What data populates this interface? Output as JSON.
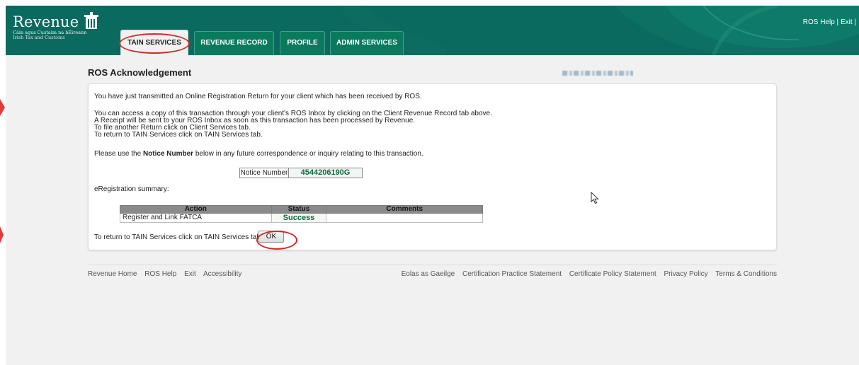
{
  "header": {
    "logo": {
      "wordmark": "Revenue",
      "subtitle_irish": "Cáin agus Custaim na hÉireann",
      "subtitle_english": "Irish Tax and Customs"
    },
    "links": {
      "help": "ROS Help",
      "separator1": " | ",
      "exit": "Exit",
      "separator2": " |"
    },
    "tabs": [
      {
        "label": "TAIN SERVICES",
        "active": true
      },
      {
        "label": "REVENUE RECORD",
        "active": false
      },
      {
        "label": "PROFILE",
        "active": false
      },
      {
        "label": "ADMIN SERVICES",
        "active": false
      }
    ],
    "colors": {
      "header_bg": "#0b6a5f",
      "tab_bg": "#0a7a5e",
      "highlight": "#d22b24"
    }
  },
  "page": {
    "title": "ROS Acknowledgement"
  },
  "panel": {
    "line1": "You have just transmitted an Online Registration Return for your client which has been received by ROS.",
    "line2": "You can access a copy of this transaction through your client's ROS Inbox by clicking on the Client Revenue Record tab above.",
    "line3": "A Receipt will be sent to your ROS Inbox as soon as this transaction has been processed by Revenue.",
    "line4": "To file another Return click on Client Services tab.",
    "line5": "To return to TAIN Services click on TAIN Services tab.",
    "notice_prefix": "Please use the ",
    "notice_bold": "Notice Number",
    "notice_suffix": " below in any future correspondence or inquiry relating to this transaction.",
    "notice_label": "Notice Number",
    "notice_value": "4544206190G",
    "summary_label": "eRegistration summary:",
    "summary_table": {
      "headers": [
        "Action",
        "Status",
        "Comments"
      ],
      "rows": [
        {
          "action": "Register and Link FATCA",
          "status": "Success",
          "comments": ""
        }
      ]
    },
    "return_text": "To return to TAIN Services click on TAIN Services tab.",
    "ok_label": "OK"
  },
  "footer": {
    "left_links": [
      "Revenue Home",
      "ROS Help",
      "Exit",
      "Accessibility"
    ],
    "right_links": [
      "Eolas as Gaeilge",
      "Certification Practice Statement",
      "Certificate Policy Statement",
      "Privacy Policy",
      "Terms & Conditions"
    ]
  },
  "icons": {
    "harp": "harp-logo-icon",
    "cursor": "mouse-pointer-icon"
  }
}
